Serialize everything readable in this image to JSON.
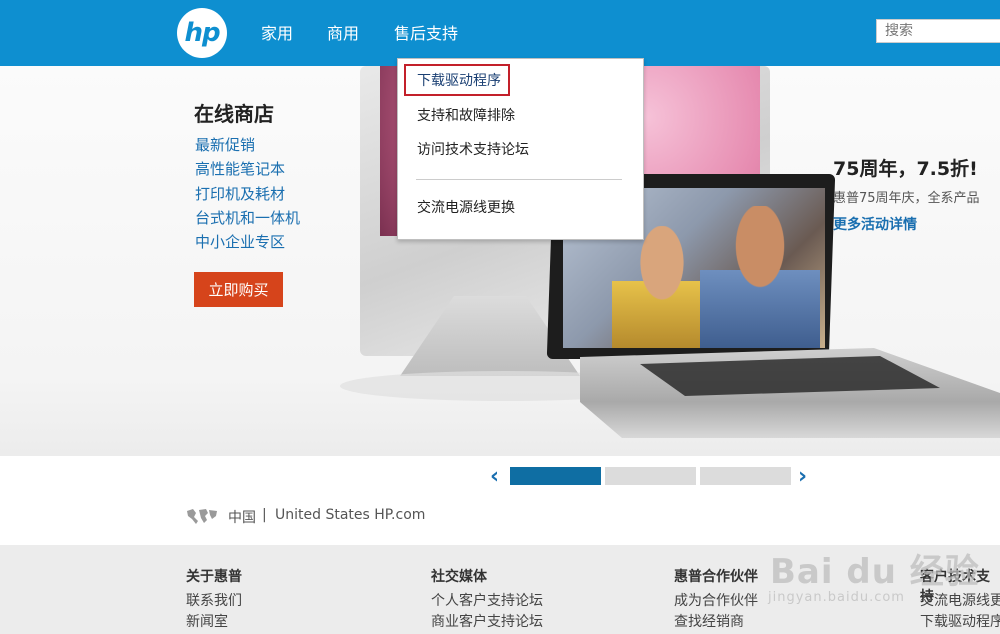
{
  "header": {
    "logo_text": "hp",
    "nav": [
      "家用",
      "商用",
      "售后支持"
    ],
    "search_placeholder": "搜索"
  },
  "dropdown": {
    "items": [
      "下载驱动程序",
      "支持和故障排除",
      "访问技术支持论坛",
      "交流电源线更换"
    ],
    "highlighted_item": "下载驱动程序"
  },
  "store": {
    "title": "在线商店",
    "links": [
      "最新促销",
      "高性能笔记本",
      "打印机及耗材",
      "台式机和一体机",
      "中小企业专区"
    ],
    "buy_label": "立即购买"
  },
  "promo": {
    "title": "75周年，7.5折!",
    "subtitle": "惠普75周年庆，全系产品",
    "link": "更多活动详情"
  },
  "carousel": {
    "slides": 3,
    "active_index": 0,
    "prev_symbol": "‹",
    "next_symbol": "›"
  },
  "locale": {
    "country": "中国",
    "separator": "|",
    "alt_site": "United States HP.com"
  },
  "footer": {
    "columns": [
      {
        "heading": "关于惠普",
        "links": [
          "联系我们",
          "新闻室"
        ]
      },
      {
        "heading": "社交媒体",
        "links": [
          "个人客户支持论坛",
          "商业客户支持论坛"
        ]
      },
      {
        "heading": "惠普合作伙伴",
        "links": [
          "成为合作伙伴",
          "查找经销商"
        ]
      },
      {
        "heading": "客户技术支持",
        "links": [
          "交流电源线更",
          "下载驱动程序"
        ]
      }
    ]
  },
  "watermark": {
    "main": "Bai du 经验",
    "sub": "jingyan.baidu.com"
  },
  "colors": {
    "header_blue": "#0e8fd0",
    "link_blue": "#1a6fb0",
    "buy_orange": "#d6441b",
    "highlight_red": "#c3202a"
  }
}
